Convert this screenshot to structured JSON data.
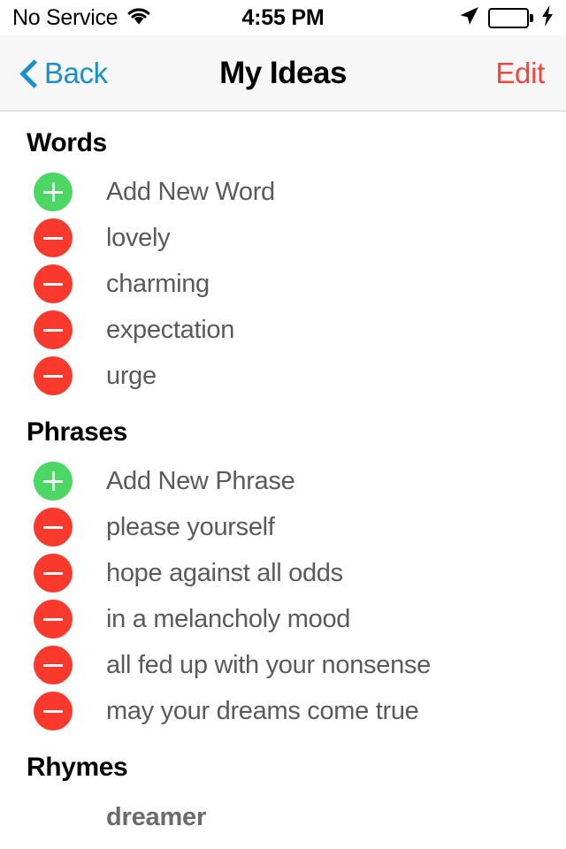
{
  "status_bar": {
    "carrier": "No Service",
    "wifi_icon": "wifi-icon",
    "time": "4:55 PM",
    "location_icon": "location-arrow-icon",
    "battery_icon": "battery-full-icon",
    "battery_charging_icon": "lightning-bolt-icon",
    "battery_color": "#4cd964"
  },
  "nav_bar": {
    "back_icon": "chevron-left-icon",
    "back_label": "Back",
    "title": "My Ideas",
    "edit_label": "Edit",
    "tint_color": "#1a8fcc",
    "edit_color": "#f0463c",
    "background_color": "#f7f7f7"
  },
  "sections": [
    {
      "header": "Words",
      "rows": [
        {
          "icon": "plus-circle-icon",
          "kind": "add",
          "label": "Add New Word"
        },
        {
          "icon": "minus-circle-icon",
          "kind": "remove",
          "label": "lovely"
        },
        {
          "icon": "minus-circle-icon",
          "kind": "remove",
          "label": "charming"
        },
        {
          "icon": "minus-circle-icon",
          "kind": "remove",
          "label": "expectation"
        },
        {
          "icon": "minus-circle-icon",
          "kind": "remove",
          "label": "urge"
        }
      ]
    },
    {
      "header": "Phrases",
      "rows": [
        {
          "icon": "plus-circle-icon",
          "kind": "add",
          "label": "Add New Phrase"
        },
        {
          "icon": "minus-circle-icon",
          "kind": "remove",
          "label": "please yourself"
        },
        {
          "icon": "minus-circle-icon",
          "kind": "remove",
          "label": "hope against all odds"
        },
        {
          "icon": "minus-circle-icon",
          "kind": "remove",
          "label": "in a melancholy mood"
        },
        {
          "icon": "minus-circle-icon",
          "kind": "remove",
          "label": "all fed up with your nonsense"
        },
        {
          "icon": "minus-circle-icon",
          "kind": "remove",
          "label": "may your dreams come true"
        }
      ]
    },
    {
      "header": "Rhymes",
      "items": [
        "dreamer"
      ]
    }
  ],
  "colors": {
    "add_button": "#4cd663",
    "remove_button": "#f9392c",
    "row_text": "#5a5a5a",
    "rhyme_text": "#6b6b6b"
  }
}
